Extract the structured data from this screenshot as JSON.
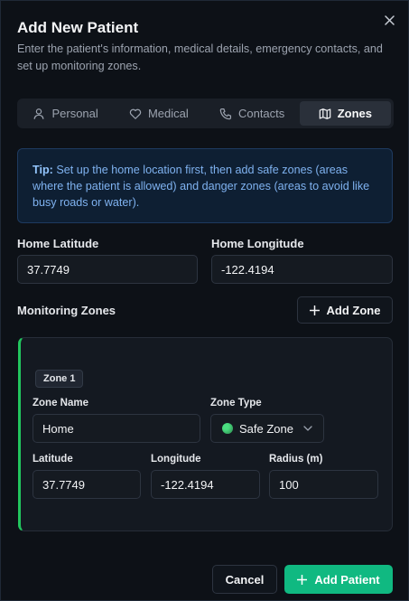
{
  "dialog": {
    "title": "Add New Patient",
    "description": "Enter the patient's information, medical details, emergency contacts, and set up monitoring zones."
  },
  "tabs": [
    {
      "label": "Personal",
      "icon": "user-icon"
    },
    {
      "label": "Medical",
      "icon": "heart-icon"
    },
    {
      "label": "Contacts",
      "icon": "phone-icon"
    },
    {
      "label": "Zones",
      "icon": "map-icon",
      "active": true
    }
  ],
  "tip": {
    "prefix": "Tip:",
    "text": " Set up the home location first, then add safe zones (areas where the patient is allowed) and danger zones (areas to avoid like busy roads or water)."
  },
  "home": {
    "latitude_label": "Home Latitude",
    "latitude_value": "37.7749",
    "longitude_label": "Home Longitude",
    "longitude_value": "-122.4194"
  },
  "zones_section": {
    "title": "Monitoring Zones",
    "add_button": "Add Zone"
  },
  "zone": {
    "badge": "Zone 1",
    "name_label": "Zone Name",
    "name_value": "Home",
    "type_label": "Zone Type",
    "type_value": "Safe Zone",
    "type_color": "#4ade80",
    "latitude_label": "Latitude",
    "latitude_value": "37.7749",
    "longitude_label": "Longitude",
    "longitude_value": "-122.4194",
    "radius_label": "Radius (m)",
    "radius_value": "100"
  },
  "footer": {
    "cancel": "Cancel",
    "submit": "Add Patient"
  },
  "colors": {
    "accent": "#10b981",
    "safe_zone": "#22c55e",
    "tip_bg": "#0e1f33"
  }
}
